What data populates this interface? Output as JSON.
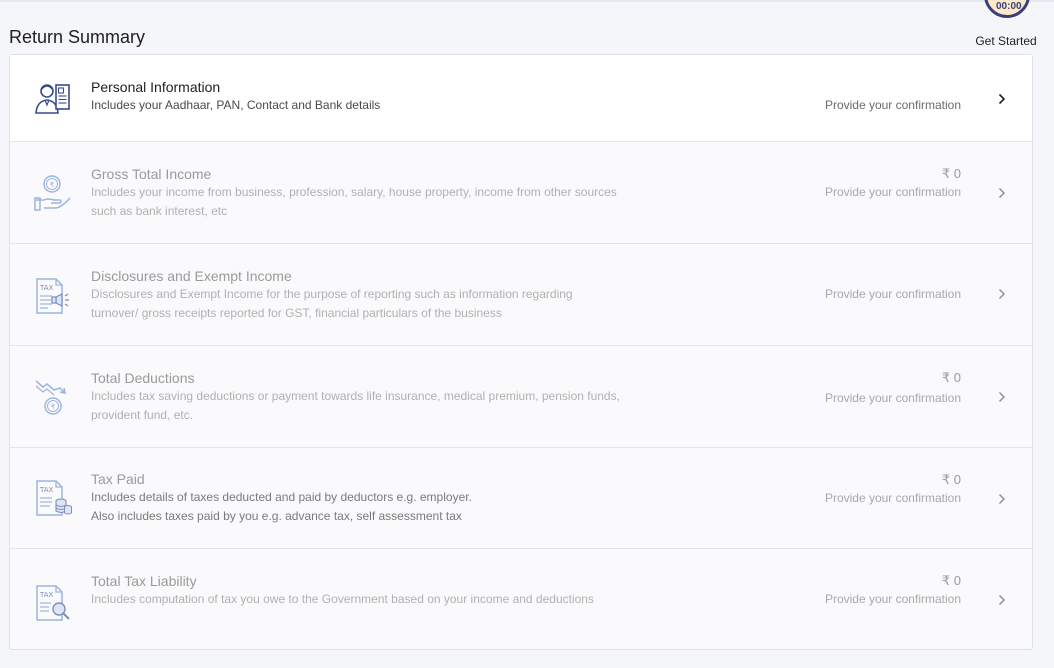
{
  "page": {
    "title": "Return Summary"
  },
  "get_started": {
    "label": "Get Started",
    "badge": "00:00"
  },
  "sections": [
    {
      "title": "Personal Information",
      "desc": "Includes your Aadhaar, PAN, Contact and Bank details",
      "amount": "",
      "status": "Provide your confirmation",
      "icon": "person-id-icon"
    },
    {
      "title": "Gross Total Income",
      "desc": "Includes your income from business, profession, salary, house property, income from other sources such as bank interest, etc",
      "amount": "₹ 0",
      "status": "Provide your confirmation",
      "icon": "rupee-hand-icon"
    },
    {
      "title": "Disclosures and Exempt Income",
      "desc": "Disclosures and Exempt Income for the purpose of reporting such as information regarding turnover/ gross receipts reported for GST, financial particulars of the business",
      "amount": "",
      "status": "Provide your confirmation",
      "icon": "tax-megaphone-icon",
      "icon_text": "TAX"
    },
    {
      "title": "Total Deductions",
      "desc": "Includes tax saving deductions or payment towards life insurance, medical premium, pension funds, provident fund, etc.",
      "amount": "₹ 0",
      "status": "Provide your confirmation",
      "icon": "down-trend-rupee-icon"
    },
    {
      "title": "Tax Paid",
      "desc_lines": [
        "Includes details of taxes deducted and paid by deductors e.g. employer.",
        "Also includes taxes paid by you e.g. advance tax, self assessment tax"
      ],
      "amount": "₹ 0",
      "status": "Provide your confirmation",
      "icon": "tax-coins-icon",
      "icon_text": "TAX"
    },
    {
      "title": "Total Tax Liability",
      "desc": "Includes computation of tax you owe to the Government based on your income and deductions",
      "amount": "₹ 0",
      "status": "Provide your confirmation",
      "icon": "tax-search-icon",
      "icon_text": "TAX"
    }
  ],
  "colors": {
    "icon_stroke": "#3a4c8a",
    "icon_light": "#9db4dd"
  }
}
